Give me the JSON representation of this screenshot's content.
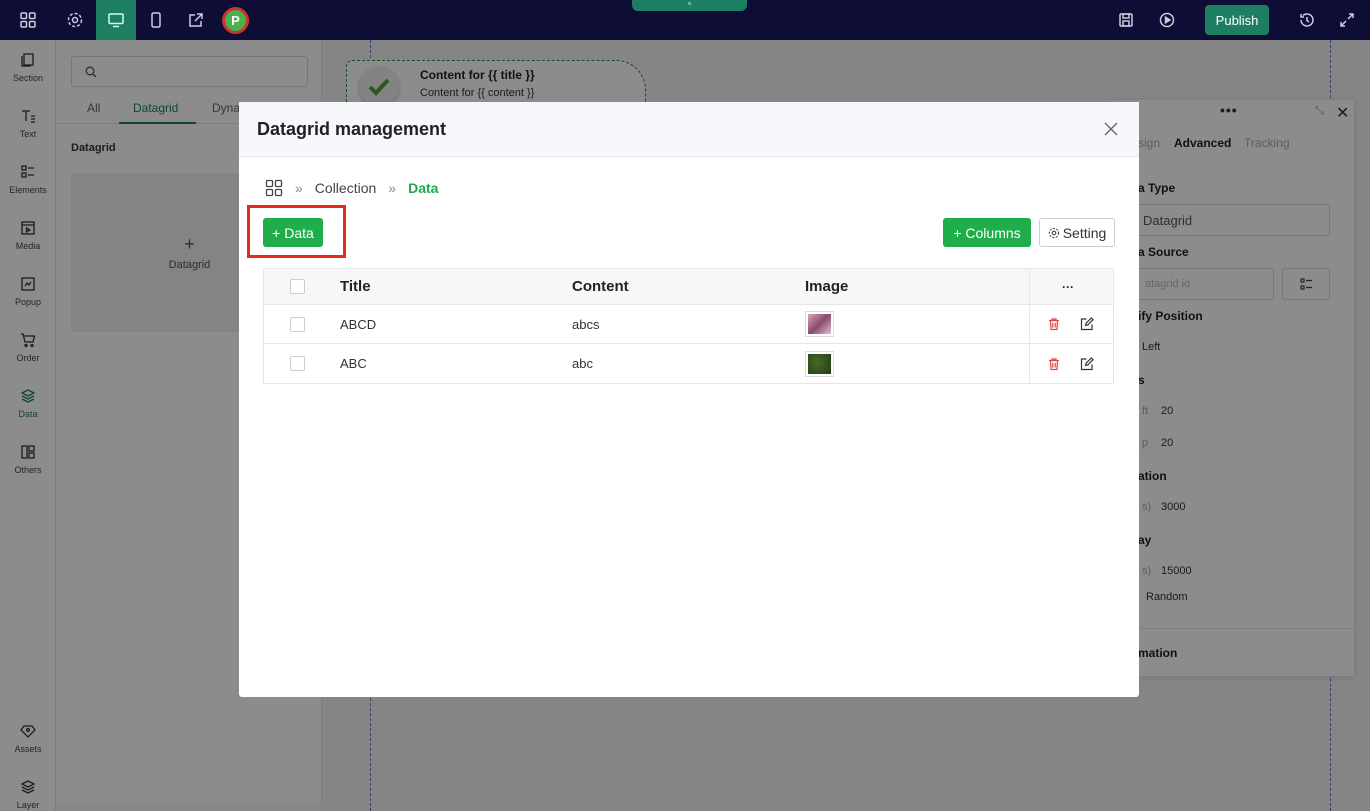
{
  "topbar": {
    "publish_label": "Publish",
    "avatar_letter": "P"
  },
  "rail": {
    "items": [
      {
        "label": "Section",
        "icon": "section-icon"
      },
      {
        "label": "Text",
        "icon": "text-icon"
      },
      {
        "label": "Elements",
        "icon": "elements-icon"
      },
      {
        "label": "Media",
        "icon": "media-icon"
      },
      {
        "label": "Popup",
        "icon": "popup-icon"
      },
      {
        "label": "Order",
        "icon": "cart-icon"
      },
      {
        "label": "Data",
        "icon": "layers-icon",
        "active": true
      },
      {
        "label": "Others",
        "icon": "others-icon"
      },
      {
        "label": "Assets",
        "icon": "diamond-icon"
      },
      {
        "label": "Layer",
        "icon": "layer-icon"
      }
    ]
  },
  "sidepanel": {
    "tabs": [
      "All",
      "Datagrid",
      "Dyna"
    ],
    "active_tab": "Datagrid",
    "section_title": "Datagrid",
    "card_label": "Datagrid",
    "card_plus": "+"
  },
  "canvas": {
    "card_title": "Content for {{ title }}",
    "card_content": "Content for {{ content }}"
  },
  "rpanel": {
    "tabs": [
      "sign",
      "Advanced",
      "Tracking"
    ],
    "active_tab": "Advanced",
    "data_type_label": "a Type",
    "data_type_value": "Datagrid",
    "data_source_label": "a Source",
    "data_source_placeholder": "atagrid id",
    "position_label": "ify Position",
    "position_value": "Left",
    "offset_label": "s",
    "left_label": "ft",
    "left_value": "20",
    "top_label": "p",
    "top_value": "20",
    "duration_label": "ation",
    "duration_unit": "s)",
    "duration_value": "3000",
    "delay_label": "ay",
    "delay_unit": "s)",
    "delay_value": "15000",
    "random_label": "Random",
    "animation_label": "mation"
  },
  "modal": {
    "title": "Datagrid management",
    "breadcrumb": [
      "Collection",
      "Data"
    ],
    "add_data_label": "+ Data",
    "add_columns_label": "+ Columns",
    "setting_label": "Setting",
    "columns": [
      "Title",
      "Content",
      "Image"
    ],
    "actions_header": "···",
    "rows": [
      {
        "title": "ABCD",
        "content": "abcs",
        "image_color": "#b46a85"
      },
      {
        "title": "ABC",
        "content": "abc",
        "image_color": "#2f4a1c"
      }
    ]
  },
  "colors": {
    "topbar": "#0d0d35",
    "brand_green": "#1e7e62",
    "button_green": "#1fae4b",
    "highlight_red": "#e8291c",
    "delete_red": "#e8423c"
  }
}
